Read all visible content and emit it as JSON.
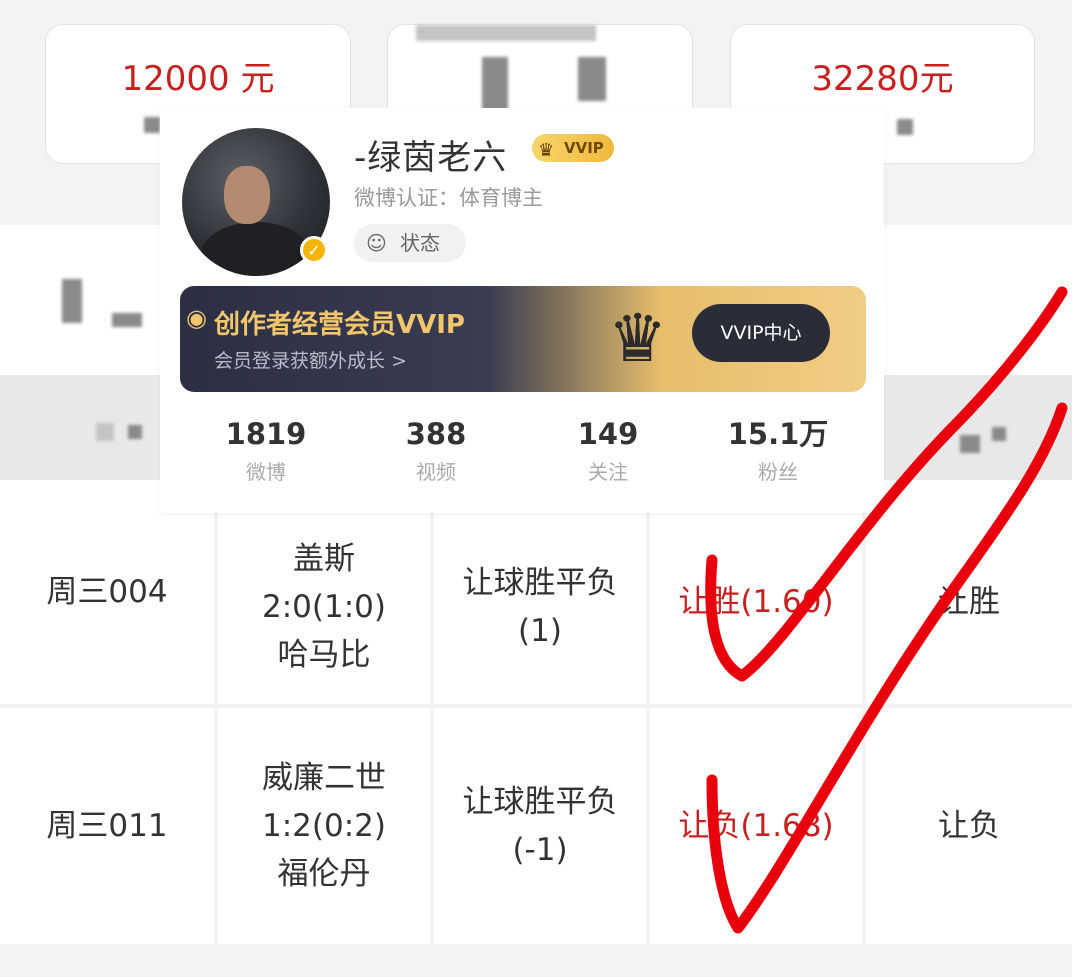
{
  "stat_cards": [
    {
      "value": "12000 元"
    },
    {
      "value": ""
    },
    {
      "value": "32280元"
    }
  ],
  "profile": {
    "name": "-绿茵老六",
    "vvip_badge": "VVIP",
    "verify": "微博认证：体育博主",
    "status_label": "状态",
    "banner": {
      "title": "创作者经营会员VVIP",
      "subtitle": "会员登录获额外成长 >",
      "button": "VVIP中心"
    },
    "stats": [
      {
        "num": "1819",
        "label": "微博"
      },
      {
        "num": "388",
        "label": "视频"
      },
      {
        "num": "149",
        "label": "关注"
      },
      {
        "num": "15.1万",
        "label": "粉丝"
      }
    ]
  },
  "table": {
    "rows": [
      {
        "id": "周三004",
        "home": "盖斯",
        "score": "2:0(1:0)",
        "away": "哈马比",
        "play_line1": "让球胜平负",
        "play_line2": "(1)",
        "pick": "让胜(1.60)",
        "result": "让胜"
      },
      {
        "id": "周三011",
        "home": "威廉二世",
        "score": "1:2(0:2)",
        "away": "福伦丹",
        "play_line1": "让球胜平负",
        "play_line2": "(-1)",
        "pick": "让负(1.68)",
        "result": "让负"
      }
    ]
  },
  "colors": {
    "accent_red": "#c8201f",
    "check_red": "#e8000d"
  }
}
